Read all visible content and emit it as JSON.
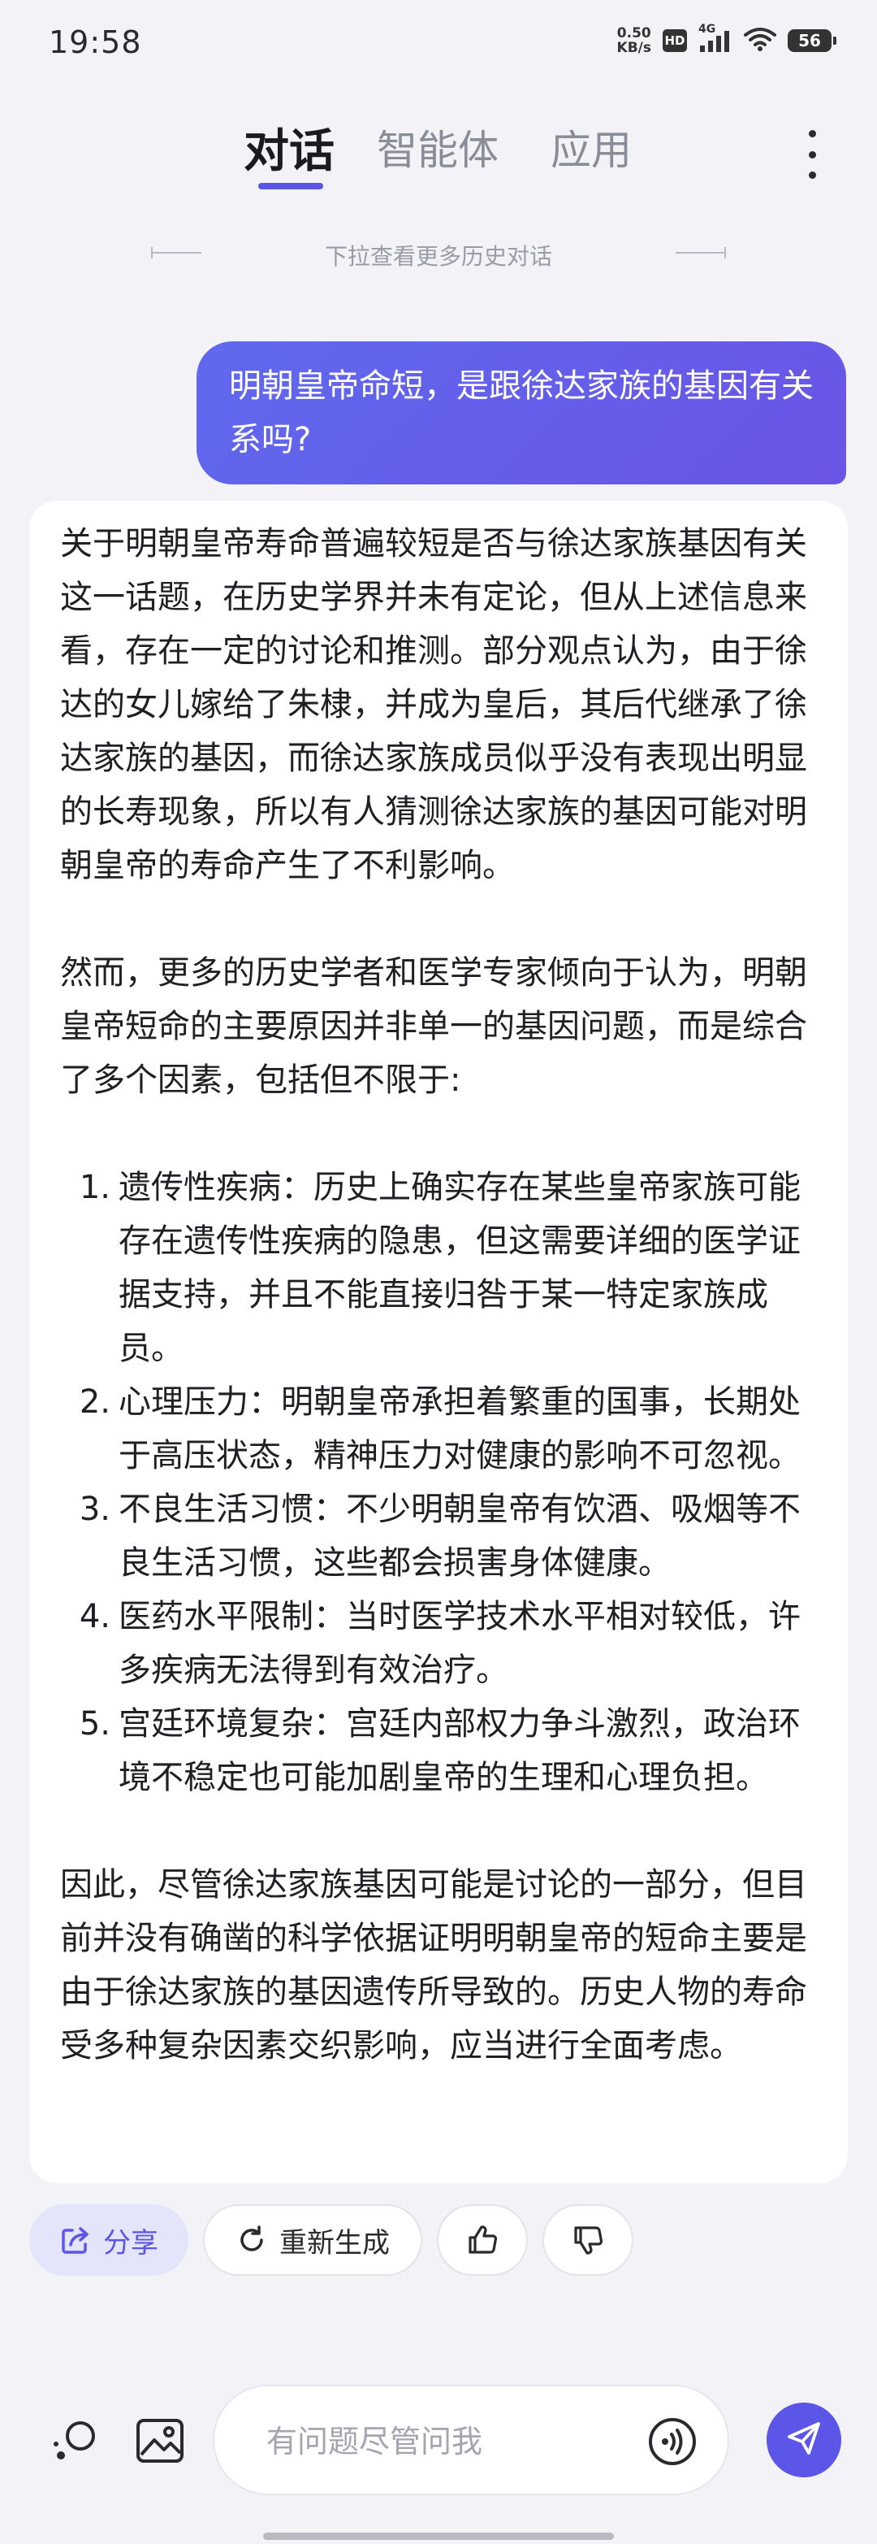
{
  "status_bar": {
    "time": "19:58",
    "net_speed_value": "0.50",
    "net_speed_unit": "KB/s",
    "hd_label": "HD",
    "network_label": "4G",
    "battery": "56"
  },
  "tabs": [
    {
      "label": "对话",
      "active": true
    },
    {
      "label": "智能体",
      "active": false
    },
    {
      "label": "应用",
      "active": false
    }
  ],
  "history_hint": "下拉查看更多历史对话",
  "user_message": "明朝皇帝命短，是跟徐达家族的基因有关系吗?",
  "answer": {
    "intro": "关于明朝皇帝寿命普遍较短是否与徐达家族基因有关这一话题，在历史学界并未有定论，但从上述信息来看，存在一定的讨论和推测。部分观点认为，由于徐达的女儿嫁给了朱棣，并成为皇后，其后代继承了徐达家族的基因，而徐达家族成员似乎没有表现出明显的长寿现象，所以有人猜测徐达家族的基因可能对明朝皇帝的寿命产生了不利影响。",
    "transition": "然而，更多的历史学者和医学专家倾向于认为，明朝皇帝短命的主要原因并非单一的基因问题，而是综合了多个因素，包括但不限于:",
    "list": [
      {
        "num": "1.",
        "text": "遗传性疾病：历史上确实存在某些皇帝家族可能存在遗传性疾病的隐患，但这需要详细的医学证据支持，并且不能直接归咎于某一特定家族成员。"
      },
      {
        "num": "2.",
        "text": "心理压力：明朝皇帝承担着繁重的国事，长期处于高压状态，精神压力对健康的影响不可忽视。"
      },
      {
        "num": "3.",
        "text": "不良生活习惯：不少明朝皇帝有饮酒、吸烟等不良生活习惯，这些都会损害身体健康。"
      },
      {
        "num": "4.",
        "text": "医药水平限制：当时医学技术水平相对较低，许多疾病无法得到有效治疗。"
      },
      {
        "num": "5.",
        "text": "宫廷环境复杂：宫廷内部权力争斗激烈，政治环境不稳定也可能加剧皇帝的生理和心理负担。"
      }
    ],
    "conclusion": "因此，尽管徐达家族基因可能是讨论的一部分，但目前并没有确凿的科学依据证明明朝皇帝的短命主要是由于徐达家族的基因遗传所导致的。历史人物的寿命受多种复杂因素交织影响，应当进行全面考虑。"
  },
  "actions": {
    "share_label": "分享",
    "regenerate_label": "重新生成",
    "like_icon": "thumbs-up-icon",
    "dislike_icon": "thumbs-down-icon"
  },
  "input": {
    "placeholder": "有问题尽管问我",
    "value": ""
  },
  "colors": {
    "accent": "#5b56e8",
    "bubble_start": "#5f69ee",
    "bubble_end": "#6a54e6",
    "background": "#f2f2f7"
  }
}
